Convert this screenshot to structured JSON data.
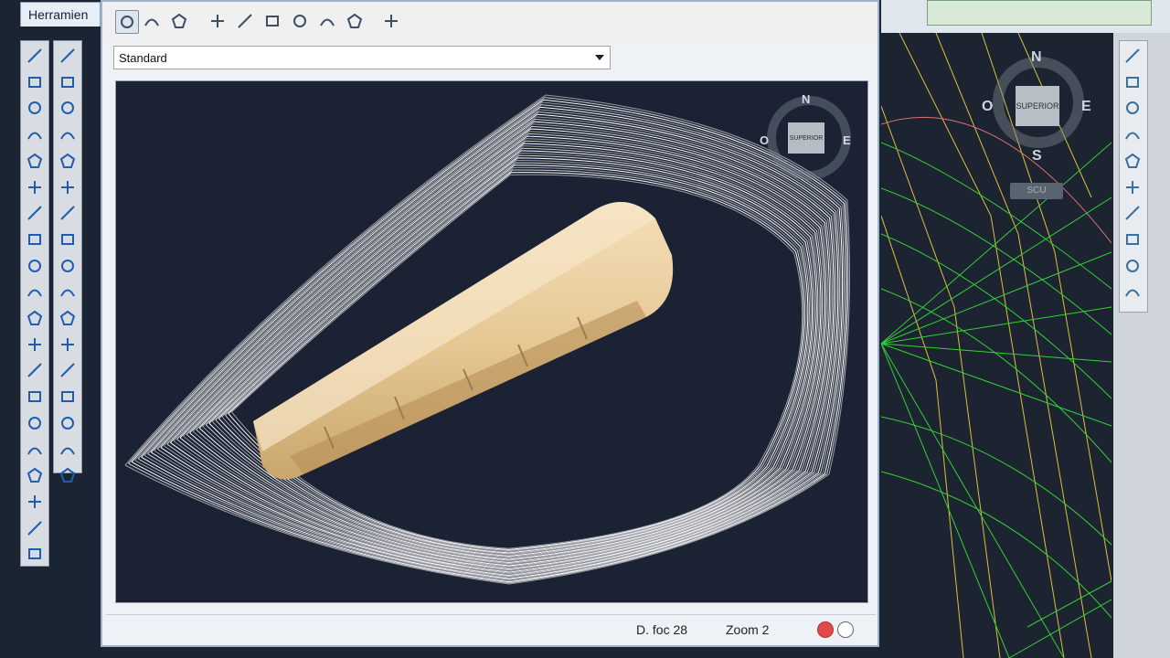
{
  "palette": {
    "tab_label": "Herramien"
  },
  "left_tools_col1": [
    "line-icon",
    "polyline-icon",
    "spline-icon",
    "polygon-icon",
    "rectangle-icon",
    "arc-icon",
    "circle-icon",
    "revision-cloud-icon",
    "spline-curve-icon",
    "ellipse-icon",
    "ellipse-arc-icon",
    "insert-block-icon",
    "make-block-icon",
    "point-icon",
    "hatch-icon",
    "gradient-icon",
    "region-icon",
    "table-icon",
    "multiline-text-icon",
    "add-selected-icon"
  ],
  "left_tools_col2": [
    "erase-icon",
    "copy-icon",
    "mirror-icon",
    "offset-icon",
    "array-icon",
    "move-icon",
    "rotate-icon",
    "scale-icon",
    "stretch-icon",
    "trim-icon",
    "extend-icon",
    "break-at-point-icon",
    "break-icon",
    "join-icon",
    "chamfer-icon",
    "fillet-icon",
    "blend-curves-icon"
  ],
  "dialog": {
    "toolbar": [
      "view-cube-icon",
      "view-isometric-icon",
      "view-orbit-icon",
      "zoom-realtime-icon",
      "zoom-in-icon",
      "zoom-window-icon",
      "zoom-extents-icon",
      "zoom-out-icon",
      "zoom-previous-icon",
      "locate-icon"
    ],
    "visual_style": {
      "value": "Standard"
    },
    "viewcube": {
      "face": "SUPERIOR",
      "north": "N",
      "east": "E",
      "west": "O"
    },
    "status": {
      "focal": "D. foc 28",
      "zoom": "Zoom 2"
    }
  },
  "cad": {
    "viewcube": {
      "face": "SUPERIOR",
      "north": "N",
      "east": "E",
      "south": "S",
      "west": "O"
    },
    "ucs_button": "SCU"
  },
  "right_tools": [
    "layer-states-icon",
    "layer-match-icon",
    "layer-previous-icon",
    "layer-isolate-icon",
    "layer-freeze-icon",
    "layer-off-icon",
    "layer-lock-icon",
    "layer-unlock-icon",
    "layer-walk-icon",
    "layer-merge-icon"
  ],
  "colors": {
    "viewport_bg": "#1b2233",
    "contour": "#ffffff",
    "object": "#e8cb9a",
    "cad_lines_green": "#35d235",
    "cad_lines_yellow": "#d9c23a"
  }
}
